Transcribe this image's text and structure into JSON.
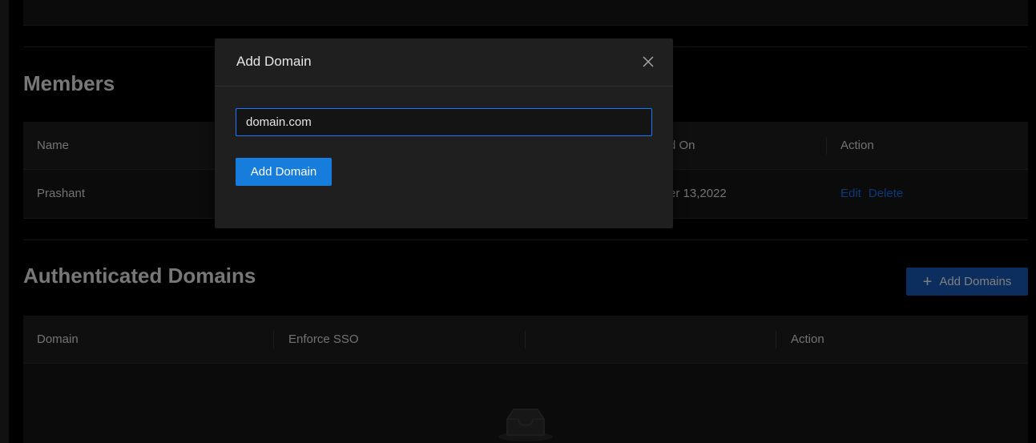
{
  "members": {
    "title": "Members",
    "columns": {
      "name": "Name",
      "added_on_partial": "d On",
      "action": "Action"
    },
    "rows": [
      {
        "name": "Prashant",
        "added_on_partial": "er 13,2022",
        "actions": {
          "edit": "Edit",
          "delete": "Delete"
        }
      }
    ]
  },
  "domains": {
    "title": "Authenticated Domains",
    "add_button": "Add Domains",
    "columns": {
      "domain": "Domain",
      "enforce_sso": "Enforce SSO",
      "blank": "",
      "action": "Action"
    },
    "empty_icon": "inbox-empty-icon"
  },
  "modal": {
    "title": "Add Domain",
    "input_value": "domain.com",
    "submit_label": "Add Domain",
    "close_icon": "close-icon"
  },
  "colors": {
    "primary": "#177ddc",
    "link": "#1668dc",
    "input_focus_border": "#1677ff",
    "background": "#000000",
    "surface": "#1f1f1f"
  }
}
